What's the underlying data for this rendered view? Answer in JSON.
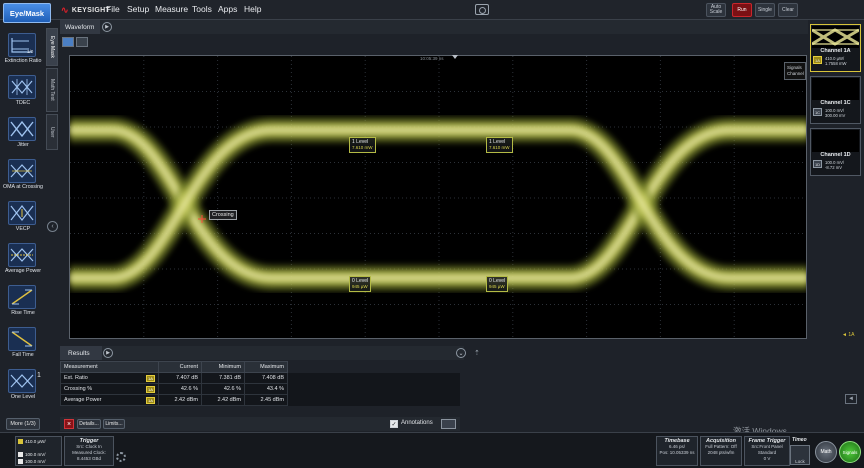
{
  "app": {
    "mode_button": "Eye/Mask",
    "brand": "KEYSIGHT",
    "menu": [
      "File",
      "Setup",
      "Measure",
      "Tools",
      "Apps",
      "Help"
    ],
    "toolbar_buttons": {
      "auto_scale": "Auto Scale",
      "run": "Run",
      "single": "Single",
      "clear": "Clear"
    }
  },
  "left_tools": [
    {
      "label": "Extinction Ratio",
      "icon": "extinction-ratio-icon"
    },
    {
      "label": "TDEC",
      "icon": "tdec-icon"
    },
    {
      "label": "Jitter",
      "icon": "jitter-icon"
    },
    {
      "label": "OMA at Crossing",
      "icon": "oma-icon"
    },
    {
      "label": "VECP",
      "icon": "vecp-icon"
    },
    {
      "label": "Average Power",
      "icon": "average-power-icon"
    },
    {
      "label": "Rise Time",
      "icon": "rise-time-icon"
    },
    {
      "label": "Fall Time",
      "icon": "fall-time-icon"
    },
    {
      "label": "One Level",
      "icon": "one-level-icon"
    }
  ],
  "extinction_badge": "1/0",
  "one_level_badge": "1",
  "more_button": "More (1/3)",
  "vertical_tabs": [
    "Eye Mask",
    "Math Test",
    "User"
  ],
  "waveform": {
    "tab": "Waveform",
    "timestamp": "10:05:39 ns",
    "signal_label": "Signals Channel",
    "markers": [
      {
        "title": "1 Level",
        "value": "7.610 mW"
      },
      {
        "title": "1 Level",
        "value": "7.610 mW"
      },
      {
        "title": "0 Level",
        "value": "945 µW"
      },
      {
        "title": "0 Level",
        "value": "945 µW"
      }
    ],
    "crossing_label": "Crossing"
  },
  "results": {
    "tab": "Results",
    "columns": [
      "Measurement",
      "Current",
      "Minimum",
      "Maximum"
    ],
    "rows": [
      {
        "name": "Ext. Ratio",
        "channel": "1A",
        "current": "7.407 dB",
        "minimum": "7.381 dB",
        "maximum": "7.408 dB"
      },
      {
        "name": "Crossing %",
        "channel": "1A",
        "current": "42.6 %",
        "minimum": "42.6 %",
        "maximum": "43.4 %"
      },
      {
        "name": "Average Power",
        "channel": "1A",
        "current": "2.42 dBm",
        "minimum": "2.42 dBm",
        "maximum": "2.45 dBm"
      }
    ],
    "details_button": "Details...",
    "limits_button": "Limits...",
    "annotations_label": "Annotations"
  },
  "channels": [
    {
      "name": "Channel 1A",
      "badge": "1A",
      "line1": "410.0 µW/",
      "line2": "1.7558 mW",
      "selected": true
    },
    {
      "name": "Channel 1C",
      "badge": "1C",
      "line1": "100.0 mV/",
      "line2": "300.00 mV",
      "selected": false
    },
    {
      "name": "Channel 1D",
      "badge": "1D",
      "line1": "100.0 mV/",
      "line2": "-8.72 mV",
      "selected": false
    }
  ],
  "level_mark": "◄ 1A",
  "watermark": "激活 Windows",
  "status": {
    "channel_rows": [
      "410.0 µW/",
      "100.0 mV/",
      "100.0 mV/"
    ],
    "trigger": {
      "title": "Trigger",
      "lines": [
        "Src: Clock In",
        "Measured Clock:",
        "8.4453 GBd"
      ]
    },
    "timebase": {
      "title": "Timebase",
      "lines": [
        "6.46 ps/",
        "Pos: 10.05339 ns"
      ]
    },
    "acquisition": {
      "title": "Acquisition",
      "lines": [
        "Full Pattern: Off",
        "2048 pts/wfm"
      ]
    },
    "frame_trigger": {
      "title": "Frame Trigger",
      "lines": [
        "Src:Front Panel",
        "Standard",
        "0 V"
      ]
    },
    "lock_label": "Lock",
    "timeout_title": "Timeo",
    "math_button": "Math",
    "signals_button": "Signals"
  }
}
